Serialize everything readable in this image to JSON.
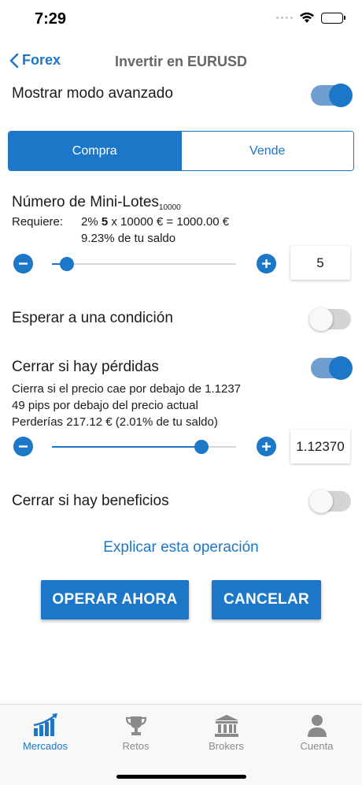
{
  "status": {
    "time": "7:29"
  },
  "nav": {
    "back_label": "Forex",
    "title": "Invertir en EURUSD"
  },
  "advanced": {
    "label": "Mostrar modo avanzado",
    "enabled": true
  },
  "segment": {
    "buy": "Compra",
    "sell": "Vende",
    "selected": "buy"
  },
  "lots": {
    "title": "Número de Mini-Lotes",
    "title_sub": "10000",
    "requires_label": "Requiere:",
    "req_pct": "2% ",
    "req_qty": "5",
    "req_rest": " x 10000 € = 1000.00 €",
    "req_line2": "9.23% de tu saldo",
    "value": "5",
    "slider_fraction": 0.08
  },
  "condition": {
    "label": "Esperar a una condición",
    "enabled": false
  },
  "stop_loss": {
    "label": "Cerrar si hay pérdidas",
    "enabled": true,
    "line1": "Cierra si el precio cae por debajo de 1.1237",
    "line2": "49 pips por debajo del precio actual",
    "line3": "Perderías 217.12 € (2.01% de tu saldo)",
    "value": "1.12370",
    "slider_fraction": 0.81
  },
  "take_profit": {
    "label": "Cerrar si hay beneficios",
    "enabled": false
  },
  "explain_link": "Explicar esta operación",
  "buttons": {
    "operate": "OPERAR AHORA",
    "cancel": "CANCELAR"
  },
  "tabs": [
    {
      "label": "Mercados",
      "icon": "chart-icon",
      "active": true
    },
    {
      "label": "Retos",
      "icon": "trophy-icon",
      "active": false
    },
    {
      "label": "Brokers",
      "icon": "bank-icon",
      "active": false
    },
    {
      "label": "Cuenta",
      "icon": "user-icon",
      "active": false
    }
  ],
  "colors": {
    "accent": "#1d77c8",
    "toggle_on_track": "#6f9fd1"
  }
}
